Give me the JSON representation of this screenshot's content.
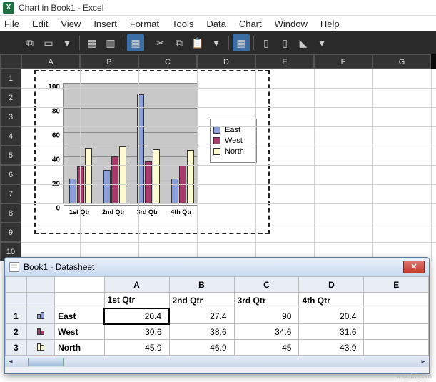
{
  "titlebar": {
    "title": "Chart in Book1 - Excel"
  },
  "menu": {
    "items": [
      "File",
      "Edit",
      "View",
      "Insert",
      "Format",
      "Tools",
      "Data",
      "Chart",
      "Window",
      "Help"
    ]
  },
  "columns": [
    "A",
    "B",
    "C",
    "D",
    "E",
    "F",
    "G"
  ],
  "rows": [
    "1",
    "2",
    "3",
    "4",
    "5",
    "6",
    "7",
    "8",
    "9",
    "10"
  ],
  "chart_data": {
    "type": "bar",
    "categories": [
      "1st Qtr",
      "2nd Qtr",
      "3rd Qtr",
      "4th Qtr"
    ],
    "series": [
      {
        "name": "East",
        "values": [
          20.4,
          27.4,
          90.0,
          20.4
        ],
        "color": "#8a9edb"
      },
      {
        "name": "West",
        "values": [
          30.6,
          38.6,
          34.6,
          31.6
        ],
        "color": "#a8396b"
      },
      {
        "name": "North",
        "values": [
          45.9,
          46.9,
          45.0,
          43.9
        ],
        "color": "#fefbd0"
      }
    ],
    "title": "",
    "xlabel": "",
    "ylabel": "",
    "ylim": [
      0,
      100
    ],
    "yticks": [
      0,
      20,
      40,
      60,
      80,
      100
    ]
  },
  "datasheet": {
    "title": "Book1 - Datasheet",
    "col_heads": [
      "A",
      "B",
      "C",
      "D",
      "E"
    ],
    "col_labels": [
      "1st Qtr",
      "2nd Qtr",
      "3rd Qtr",
      "4th Qtr"
    ],
    "rows": [
      {
        "n": "1",
        "name": "East",
        "vals": [
          "20.4",
          "27.4",
          "90",
          "20.4"
        ]
      },
      {
        "n": "2",
        "name": "West",
        "vals": [
          "30.6",
          "38.6",
          "34.6",
          "31.6"
        ]
      },
      {
        "n": "3",
        "name": "North",
        "vals": [
          "45.9",
          "46.9",
          "45",
          "43.9"
        ]
      }
    ],
    "selected": [
      0,
      0
    ]
  },
  "watermark": "wsxdn.com"
}
